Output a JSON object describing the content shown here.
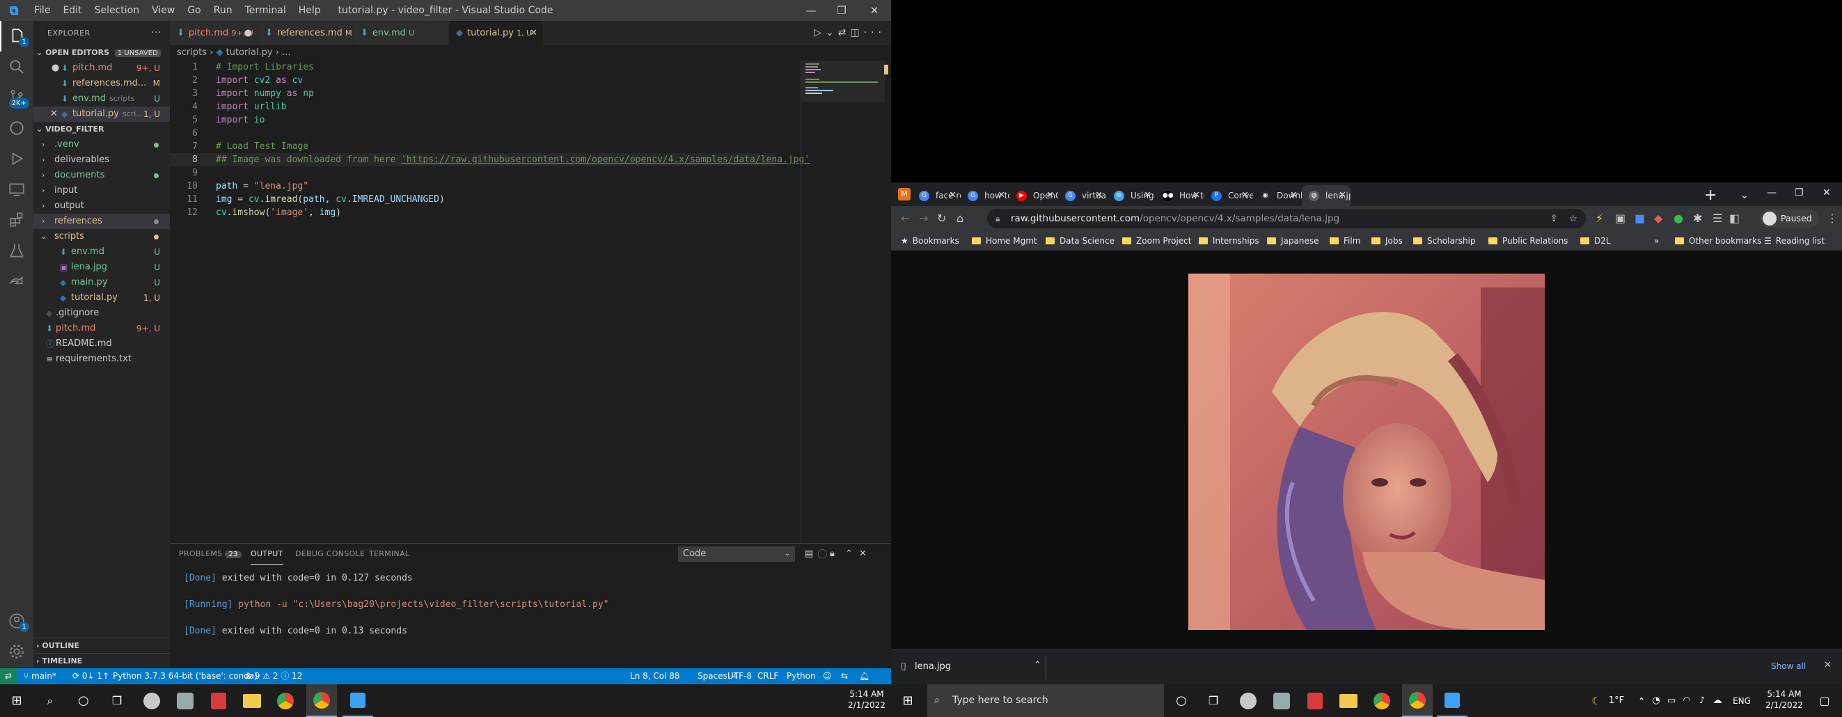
{
  "vscode": {
    "window_title": "tutorial.py - video_filter - Visual Studio Code",
    "menu": [
      "File",
      "Edit",
      "Selection",
      "View",
      "Go",
      "Run",
      "Terminal",
      "Help"
    ],
    "explorer_title": "EXPLORER",
    "open_editors": {
      "header": "OPEN EDITORS",
      "badge": "1 UNSAVED",
      "items": [
        {
          "name": "pitch.md",
          "desc": "",
          "status": "9+, U"
        },
        {
          "name": "references.md...",
          "desc": "",
          "status": "M"
        },
        {
          "name": "env.md",
          "desc": "scripts",
          "status": "U"
        },
        {
          "name": "tutorial.py",
          "desc": "scri...",
          "status": "1, U"
        }
      ]
    },
    "folder": {
      "header": "VIDEO_FILTER",
      "items": [
        {
          "name": ".venv",
          "status": ""
        },
        {
          "name": "deliverables",
          "status": ""
        },
        {
          "name": "documents",
          "status": ""
        },
        {
          "name": "input",
          "status": ""
        },
        {
          "name": "output",
          "status": ""
        },
        {
          "name": "references",
          "status": ""
        },
        {
          "name": "scripts",
          "status": ""
        },
        {
          "name": "env.md",
          "status": "U"
        },
        {
          "name": "lena.jpg",
          "status": "U"
        },
        {
          "name": "main.py",
          "status": "U"
        },
        {
          "name": "tutorial.py",
          "status": "1, U"
        },
        {
          "name": ".gitignore",
          "status": ""
        },
        {
          "name": "pitch.md",
          "status": "9+, U"
        },
        {
          "name": "README.md",
          "status": ""
        },
        {
          "name": "requirements.txt",
          "status": ""
        }
      ]
    },
    "outline": "OUTLINE",
    "timeline": "TIMELINE",
    "tabs": [
      {
        "name": "pitch.md",
        "status": "9+, U"
      },
      {
        "name": "references.md",
        "status": "M"
      },
      {
        "name": "env.md",
        "status": "U"
      },
      {
        "name": "tutorial.py",
        "status": "1, U"
      }
    ],
    "breadcrumb": {
      "folder": "scripts",
      "file": "tutorial.py",
      "rest": "..."
    },
    "code_lines": [
      "# Import Libraries",
      "import cv2 as cv",
      "import numpy as np",
      "import urllib",
      "import io",
      "",
      "# Load Test Image",
      "## Image was downloaded from here 'https://raw.githubusercontent.com/opencv/opencv/4.x/samples/data/lena.jpg'",
      "",
      "path = \"lena.jpg\"",
      "img = cv.imread(path, cv.IMREAD_UNCHANGED)",
      "cv.imshow('image', img)"
    ],
    "panel": {
      "tabs": [
        "PROBLEMS",
        "OUTPUT",
        "DEBUG CONSOLE",
        "TERMINAL"
      ],
      "problems_count": "23",
      "select_value": "Code",
      "output": [
        {
          "tag": "[Done]",
          "text": " exited with code=0 in 0.127 seconds"
        },
        {
          "tag": "",
          "text": ""
        },
        {
          "tag": "[Running]",
          "text": " python -u \"c:\\Users\\bag20\\projects\\video_filter\\scripts\\tutorial.py\""
        },
        {
          "tag": "",
          "text": ""
        },
        {
          "tag": "[Done]",
          "text": " exited with code=0 in 0.13 seconds"
        }
      ]
    },
    "status": {
      "branch": "main*",
      "sync": "0↓ 1↑",
      "python": "Python 3.7.3 64-bit ('base': conda)",
      "problems": "⊗ 9 ⚠ 2 ⓘ 12",
      "position": "Ln 8, Col 88",
      "spaces": "Spaces: 4",
      "encoding": "UTF-8",
      "eol": "CRLF",
      "language": "Python"
    },
    "badges": {
      "explorer": "1",
      "scm": "2K+",
      "accounts": "1"
    }
  },
  "chrome": {
    "tabs": [
      {
        "title": "face reco",
        "icon": "google"
      },
      {
        "title": "how to d",
        "icon": "google"
      },
      {
        "title": "OpenCV",
        "icon": "youtube"
      },
      {
        "title": "virtual en",
        "icon": "google"
      },
      {
        "title": "Using Pyt",
        "icon": "vscode"
      },
      {
        "title": "How to S",
        "icon": "medium"
      },
      {
        "title": "Convert I",
        "icon": "p"
      },
      {
        "title": "Downloa",
        "icon": "github"
      },
      {
        "title": "lena.jpg (",
        "icon": "globe"
      }
    ],
    "url_host": "raw.githubusercontent.com",
    "url_path": "/opencv/opencv/4.x/samples/data/lena.jpg",
    "profile": "Paused",
    "bookmarks": [
      "Bookmarks",
      "Home Mgmt",
      "Data Science",
      "Zoom Project",
      "Internships",
      "Japanese",
      "Film",
      "Jobs",
      "Scholarship",
      "Public Relations",
      "D2L"
    ],
    "other_bookmarks": "Other bookmarks",
    "reading_list": "Reading list",
    "download": {
      "file": "lena.jpg",
      "show_all": "Show all"
    }
  },
  "taskbar": {
    "search_placeholder": "Type here to search",
    "weather": "1°F",
    "lang": "ENG",
    "time": "5:14 AM",
    "date": "2/1/2022"
  },
  "colors": {
    "vscode_blue": "#007acc",
    "accent": "#3da2f5",
    "modified": "#e2c08d",
    "untracked": "#73c991",
    "error": "#f48771"
  }
}
